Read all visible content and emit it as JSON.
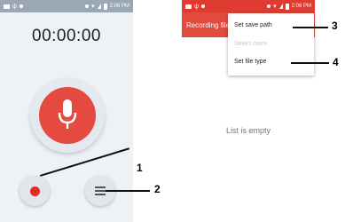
{
  "left_screen": {
    "status_time": "2:06 PM",
    "timer": "00:00:00"
  },
  "right_screen": {
    "status_time": "2:06 PM",
    "app_title": "Recording file",
    "menu": [
      {
        "label": "Set save path",
        "enabled": true
      },
      {
        "label": "Select more",
        "enabled": false
      },
      {
        "label": "Set file type",
        "enabled": true
      }
    ],
    "empty_text": "List is empty"
  },
  "callouts": [
    "1",
    "2",
    "3",
    "4"
  ],
  "colors": {
    "accent_red": "#e44a3f",
    "record_dot": "#e12a2a",
    "appbar": "#e34a3e"
  },
  "icons": [
    "microphone-icon",
    "record-dot-icon",
    "list-menu-icon"
  ]
}
